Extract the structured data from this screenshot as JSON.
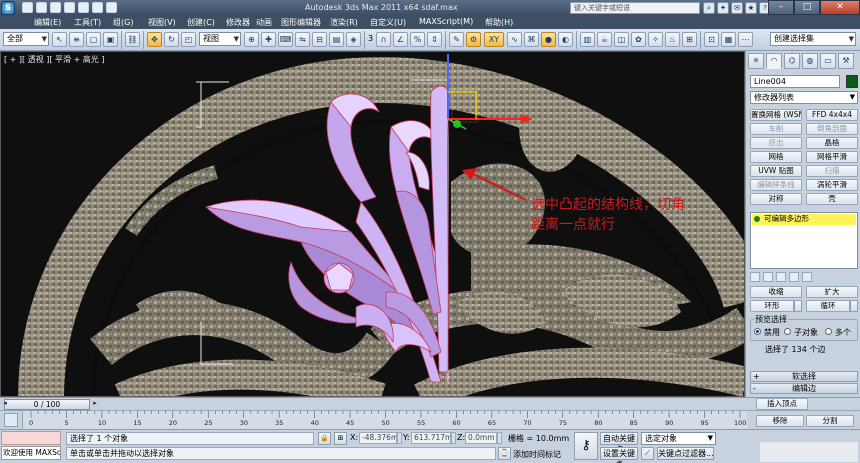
{
  "app": {
    "window_title": "Autodesk 3ds Max  2011 x64    sdaf.max",
    "search_placeholder": "键入关键字或短语",
    "logo_letter": "S"
  },
  "menu": [
    "编辑(E)",
    "工具(T)",
    "组(G)",
    "视图(V)",
    "创建(C)",
    "修改器",
    "动画",
    "图形编辑器",
    "渲染(R)",
    "自定义(U)",
    "MAXScript(M)",
    "帮助(H)"
  ],
  "toolbar": {
    "selection_filter": "全部",
    "reference_coord": "视图",
    "snap_label": "3",
    "named_selection": "创建选择集",
    "xy_label": "XY"
  },
  "viewport": {
    "label": "[ + ][ 透视 ][ 平滑 + 高光 ]",
    "annotation_line1": "选中凸起的结构线，切角",
    "annotation_line2": "距离一点就行"
  },
  "command_panel": {
    "object_name": "Line004",
    "modifier_list": "修改器列表",
    "buttons": [
      {
        "label": "置换网格 (WSM)",
        "enabled": true
      },
      {
        "label": "FFD 4x4x4",
        "enabled": true
      },
      {
        "label": "车削",
        "enabled": false
      },
      {
        "label": "倒角剖面",
        "enabled": false
      },
      {
        "label": "挤出",
        "enabled": false
      },
      {
        "label": "晶格",
        "enabled": true
      },
      {
        "label": "网格",
        "enabled": true
      },
      {
        "label": "网格平滑",
        "enabled": true
      },
      {
        "label": "UVW 贴图",
        "enabled": true
      },
      {
        "label": "扫描",
        "enabled": false
      },
      {
        "label": "编辑样条线",
        "enabled": false
      },
      {
        "label": "涡轮平滑",
        "enabled": true
      },
      {
        "label": "对称",
        "enabled": true
      },
      {
        "label": "壳",
        "enabled": true
      }
    ],
    "stack_item": "可编辑多边形",
    "stack_icon_color": "#1f7f1f",
    "selection": {
      "shrink": "收缩",
      "grow": "扩大",
      "ring": "环形",
      "loop": "循环",
      "preview_header": "预览选择",
      "preview_options": [
        "禁用",
        "子对象",
        "多个"
      ],
      "preview_selected": 0,
      "selected_count": "选择了 134 个边"
    },
    "rollouts": {
      "soft_selection": "软选择",
      "edit_edges": "编辑边"
    },
    "insert_vertex": "插入顶点",
    "remove": "移除",
    "split": "分割"
  },
  "timeline": {
    "thumb_label": "0 / 100",
    "ticks": [
      0,
      5,
      10,
      15,
      20,
      25,
      30,
      35,
      40,
      45,
      50,
      55,
      60,
      65,
      70,
      75,
      80,
      85,
      90,
      95,
      100
    ]
  },
  "status": {
    "maxscript_welcome": "欢迎使用 MAXSc",
    "selected_objects": "选择了 1 个对象",
    "prompt": "单击或单击并拖动以选择对象",
    "x_label": "X:",
    "x_value": "-48.376mm",
    "y_label": "Y:",
    "y_value": "613.717mm",
    "z_label": "Z:",
    "z_value": "0.0mm",
    "grid": "栅格 = 10.0mm",
    "auto_key": "自动关键点",
    "set_key": "设置关键点",
    "key_mode": "选定对象",
    "add_time_tag": "添加时间标记",
    "key_filters": "关键点过滤器..."
  }
}
